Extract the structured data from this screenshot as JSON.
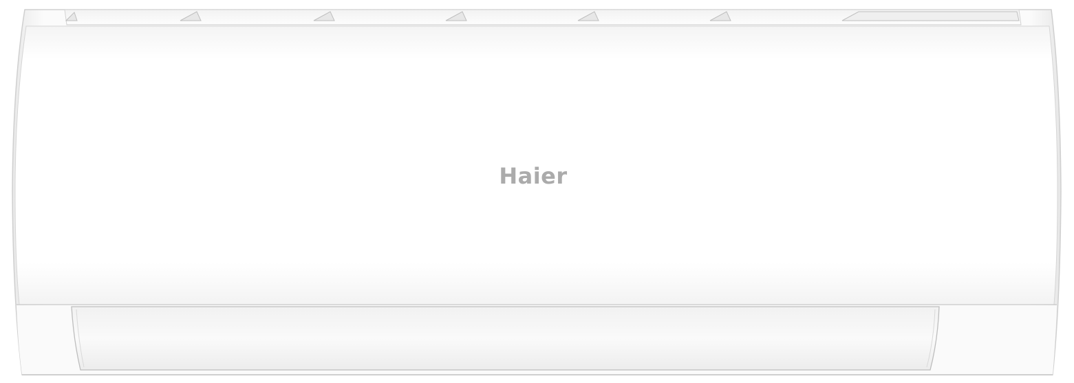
{
  "product": {
    "brand": "Haier",
    "type": "wall-mounted air conditioner indoor unit",
    "body_color": "#ffffff",
    "logo_color": "#ababab",
    "outline_color": "#cfcfcf"
  }
}
